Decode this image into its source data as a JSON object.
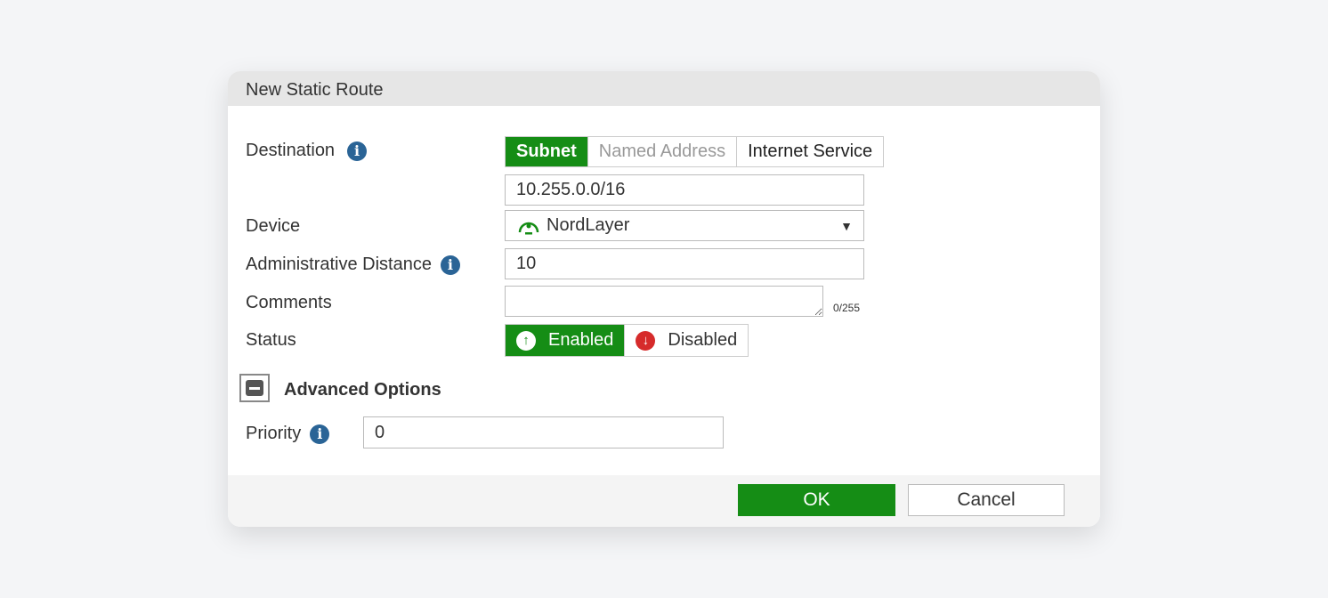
{
  "dialog": {
    "title": "New Static Route"
  },
  "destination": {
    "label": "Destination",
    "options": [
      "Subnet",
      "Named Address",
      "Internet Service"
    ],
    "selected": "Subnet",
    "value": "10.255.0.0/16"
  },
  "device": {
    "label": "Device",
    "value": "NordLayer"
  },
  "admin_distance": {
    "label": "Administrative Distance",
    "value": "10"
  },
  "comments": {
    "label": "Comments",
    "value": "",
    "counter": "0/255"
  },
  "status": {
    "label": "Status",
    "options": [
      "Enabled",
      "Disabled"
    ],
    "selected": "Enabled"
  },
  "advanced": {
    "label": "Advanced Options",
    "expanded": true
  },
  "priority": {
    "label": "Priority",
    "value": "0"
  },
  "footer": {
    "ok": "OK",
    "cancel": "Cancel"
  },
  "colors": {
    "accent": "#158d15",
    "info": "#2a6496",
    "disabled": "#d62b2b"
  }
}
